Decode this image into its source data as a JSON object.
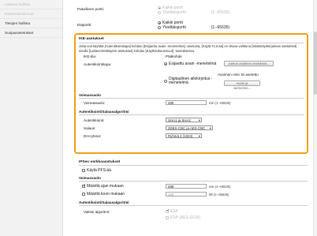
{
  "sidebar": {
    "items": [
      {
        "label": "Laitteen hallinta"
      },
      {
        "label": "Käyttöoikeusmuut."
      },
      {
        "label": "Tietojen hallinta"
      },
      {
        "label": "Suojausasetukset"
      }
    ]
  },
  "top": {
    "perfect_forward": {
      "label": "Pakollinen portti:",
      "opt1": "Kaikki portit",
      "opt2": "Yksittäisportti",
      "range": "(1--65535)"
    },
    "remote_port": {
      "label": "Etäportti:",
      "opt1": "Kaikki portit",
      "opt2": "Yksittäisportti",
      "range": "(1--65535)"
    }
  },
  "ike": {
    "title": "IKE-asetukset",
    "description": "Jotta voit käyttää [Autentikointitapa] kohdan [Esijaettu avain -menetelmä] -asetusta, [Käytä TLS:ää] on oltava valittuna [Sääntötyökirjaiman asetukset] -sivulla [Laitteen/etäkäytön asetukset] kohdan [Käyttöoikeusmuut] -asetuksessa.",
    "mode_label": "IKE-tila:",
    "mode_value": "Pääkohde",
    "auth_label": "Autentikointitapa:",
    "auth_opt1": "Esijaettu avain -menetelmä",
    "preshared_button": "Jaetun avaimen asetukset...",
    "key_status": "Avaimen nimi: Ei asetettu",
    "auth_opt2": "Digitaalinen allekirjoitus -menetelmä",
    "key_button": "Avain ja varmenne...",
    "validity": {
      "title": "Voimassaolo",
      "label": "Voimassaolo:",
      "value": "480",
      "hint": "min (1--65535)"
    },
    "crypto": {
      "title": "Autentikointi/Salausalgoritmi",
      "auth_label": "Autentikointi:",
      "auth_value": "SHA1 ja SHA2",
      "enc_label": "Salaus:",
      "enc_value": "3DES-CBC ja AES-CBC",
      "dh_label": "DH-ryhmä:",
      "dh_value": "Ryhmä 2 (1024)"
    }
  },
  "ipsec": {
    "title": "IPSec-verkkoasetukset",
    "pfs_label": "Käytä PFS:ää",
    "validity_title": "Voimassaolo",
    "time_label": "Määritä ajan mukaan",
    "time_value": "480",
    "time_hint": "min (1--65535)",
    "size_label": "Määritä koon mukaan",
    "size_value": "100",
    "size_hint": "Mt (1--65535)",
    "crypto_title": "Autentikointi/Salausalgoritmi",
    "algo_label": "Valitse algoritmi:",
    "algo_opt1": "ESP",
    "algo_opt2": "ESP (AES-GCM)"
  },
  "colors": {
    "highlight": "#f0a11a"
  }
}
